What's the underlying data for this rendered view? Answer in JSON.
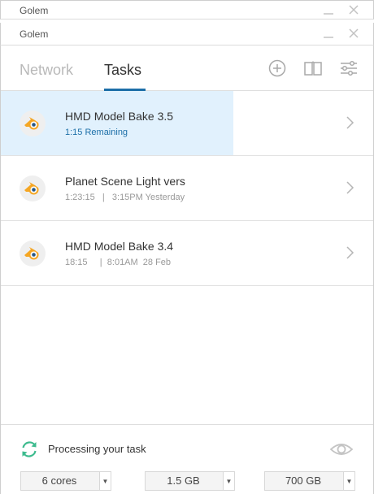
{
  "windows": [
    {
      "title": "Golem"
    },
    {
      "title": "Golem"
    }
  ],
  "nav": {
    "tabs": [
      "Network",
      "Tasks"
    ],
    "active_tab": "Tasks",
    "icons": [
      "add-icon",
      "docs-book-icon",
      "settings-sliders-icon"
    ]
  },
  "tasks": [
    {
      "name": "HMD Model Bake 3.5",
      "meta": "1:15 Remaining",
      "selected": true,
      "icon": "blender-icon"
    },
    {
      "name": "Planet Scene Light vers",
      "meta": "1:23:15   |   3:15PM Yesterday",
      "selected": false,
      "icon": "blender-icon"
    },
    {
      "name": "HMD Model Bake 3.4",
      "meta": "18:15     |  8:01AM  28 Feb",
      "selected": false,
      "icon": "blender-icon"
    }
  ],
  "status": {
    "text": "Processing your task",
    "icon": "sync-icon",
    "toggle_icon": "eye-icon"
  },
  "resources": {
    "cores": "6 cores",
    "ram": "1.5 GB",
    "disk": "700 GB"
  },
  "colors": {
    "accent": "#1d6fa8",
    "selected_row": "#e1f1fd",
    "sync_green": "#3dbb8e",
    "blender_orange": "#f5a623",
    "blender_blue": "#265787"
  }
}
